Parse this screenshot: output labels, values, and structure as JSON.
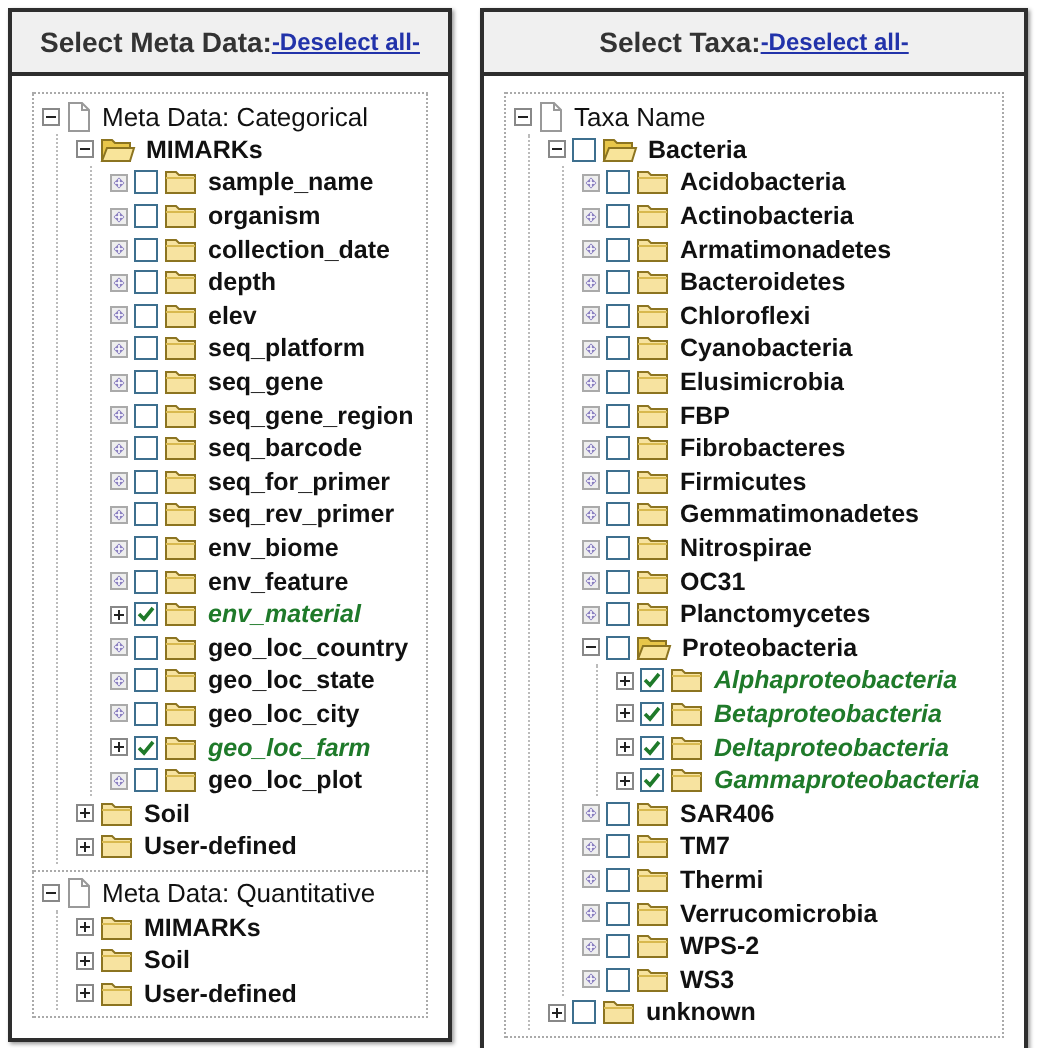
{
  "panels": [
    {
      "title": "Select Meta Data:",
      "link": "-Deselect all-",
      "sections": [
        {
          "kind": "page",
          "label": "Meta Data: Categorical",
          "expanded": true,
          "children": [
            {
              "kind": "folder",
              "label": "MIMARKs",
              "expanded": true,
              "children": [
                {
                  "kind": "folder",
                  "label": "sample_name",
                  "expanded": false,
                  "lazy": true,
                  "checked": false
                },
                {
                  "kind": "folder",
                  "label": "organism",
                  "expanded": false,
                  "lazy": true,
                  "checked": false
                },
                {
                  "kind": "folder",
                  "label": "collection_date",
                  "expanded": false,
                  "lazy": true,
                  "checked": false
                },
                {
                  "kind": "folder",
                  "label": "depth",
                  "expanded": false,
                  "lazy": true,
                  "checked": false
                },
                {
                  "kind": "folder",
                  "label": "elev",
                  "expanded": false,
                  "lazy": true,
                  "checked": false
                },
                {
                  "kind": "folder",
                  "label": "seq_platform",
                  "expanded": false,
                  "lazy": true,
                  "checked": false
                },
                {
                  "kind": "folder",
                  "label": "seq_gene",
                  "expanded": false,
                  "lazy": true,
                  "checked": false
                },
                {
                  "kind": "folder",
                  "label": "seq_gene_region",
                  "expanded": false,
                  "lazy": true,
                  "checked": false
                },
                {
                  "kind": "folder",
                  "label": "seq_barcode",
                  "expanded": false,
                  "lazy": true,
                  "checked": false
                },
                {
                  "kind": "folder",
                  "label": "seq_for_primer",
                  "expanded": false,
                  "lazy": true,
                  "checked": false
                },
                {
                  "kind": "folder",
                  "label": "seq_rev_primer",
                  "expanded": false,
                  "lazy": true,
                  "checked": false
                },
                {
                  "kind": "folder",
                  "label": "env_biome",
                  "expanded": false,
                  "lazy": true,
                  "checked": false
                },
                {
                  "kind": "folder",
                  "label": "env_feature",
                  "expanded": false,
                  "lazy": true,
                  "checked": false
                },
                {
                  "kind": "folder",
                  "label": "env_material",
                  "expanded": false,
                  "lazy": false,
                  "checked": true
                },
                {
                  "kind": "folder",
                  "label": "geo_loc_country",
                  "expanded": false,
                  "lazy": true,
                  "checked": false
                },
                {
                  "kind": "folder",
                  "label": "geo_loc_state",
                  "expanded": false,
                  "lazy": true,
                  "checked": false
                },
                {
                  "kind": "folder",
                  "label": "geo_loc_city",
                  "expanded": false,
                  "lazy": true,
                  "checked": false
                },
                {
                  "kind": "folder",
                  "label": "geo_loc_farm",
                  "expanded": false,
                  "lazy": false,
                  "checked": true
                },
                {
                  "kind": "folder",
                  "label": "geo_loc_plot",
                  "expanded": false,
                  "lazy": true,
                  "checked": false
                }
              ]
            },
            {
              "kind": "folder",
              "label": "Soil",
              "expanded": false,
              "lazy": false
            },
            {
              "kind": "folder",
              "label": "User-defined",
              "expanded": false,
              "lazy": false
            }
          ]
        },
        {
          "kind": "page",
          "label": "Meta Data: Quantitative",
          "expanded": true,
          "children": [
            {
              "kind": "folder",
              "label": "MIMARKs",
              "expanded": false,
              "lazy": false
            },
            {
              "kind": "folder",
              "label": "Soil",
              "expanded": false,
              "lazy": false
            },
            {
              "kind": "folder",
              "label": "User-defined",
              "expanded": false,
              "lazy": false
            }
          ]
        }
      ]
    },
    {
      "title": "Select Taxa:",
      "link": "-Deselect all-",
      "sections": [
        {
          "kind": "page",
          "label": "Taxa Name",
          "expanded": true,
          "children": [
            {
              "kind": "folder",
              "label": "Bacteria",
              "expanded": true,
              "checked": false,
              "children": [
                {
                  "kind": "folder",
                  "label": "Acidobacteria",
                  "expanded": false,
                  "lazy": true,
                  "checked": false
                },
                {
                  "kind": "folder",
                  "label": "Actinobacteria",
                  "expanded": false,
                  "lazy": true,
                  "checked": false
                },
                {
                  "kind": "folder",
                  "label": "Armatimonadetes",
                  "expanded": false,
                  "lazy": true,
                  "checked": false
                },
                {
                  "kind": "folder",
                  "label": "Bacteroidetes",
                  "expanded": false,
                  "lazy": true,
                  "checked": false
                },
                {
                  "kind": "folder",
                  "label": "Chloroflexi",
                  "expanded": false,
                  "lazy": true,
                  "checked": false
                },
                {
                  "kind": "folder",
                  "label": "Cyanobacteria",
                  "expanded": false,
                  "lazy": true,
                  "checked": false
                },
                {
                  "kind": "folder",
                  "label": "Elusimicrobia",
                  "expanded": false,
                  "lazy": true,
                  "checked": false
                },
                {
                  "kind": "folder",
                  "label": "FBP",
                  "expanded": false,
                  "lazy": true,
                  "checked": false
                },
                {
                  "kind": "folder",
                  "label": "Fibrobacteres",
                  "expanded": false,
                  "lazy": true,
                  "checked": false
                },
                {
                  "kind": "folder",
                  "label": "Firmicutes",
                  "expanded": false,
                  "lazy": true,
                  "checked": false
                },
                {
                  "kind": "folder",
                  "label": "Gemmatimonadetes",
                  "expanded": false,
                  "lazy": true,
                  "checked": false
                },
                {
                  "kind": "folder",
                  "label": "Nitrospirae",
                  "expanded": false,
                  "lazy": true,
                  "checked": false
                },
                {
                  "kind": "folder",
                  "label": "OC31",
                  "expanded": false,
                  "lazy": true,
                  "checked": false
                },
                {
                  "kind": "folder",
                  "label": "Planctomycetes",
                  "expanded": false,
                  "lazy": true,
                  "checked": false
                },
                {
                  "kind": "folder",
                  "label": "Proteobacteria",
                  "expanded": true,
                  "checked": false,
                  "children": [
                    {
                      "kind": "folder",
                      "label": "Alphaproteobacteria",
                      "expanded": false,
                      "lazy": false,
                      "checked": true
                    },
                    {
                      "kind": "folder",
                      "label": "Betaproteobacteria",
                      "expanded": false,
                      "lazy": false,
                      "checked": true
                    },
                    {
                      "kind": "folder",
                      "label": "Deltaproteobacteria",
                      "expanded": false,
                      "lazy": false,
                      "checked": true
                    },
                    {
                      "kind": "folder",
                      "label": "Gammaproteobacteria",
                      "expanded": false,
                      "lazy": false,
                      "checked": true
                    }
                  ]
                },
                {
                  "kind": "folder",
                  "label": "SAR406",
                  "expanded": false,
                  "lazy": true,
                  "checked": false
                },
                {
                  "kind": "folder",
                  "label": "TM7",
                  "expanded": false,
                  "lazy": true,
                  "checked": false
                },
                {
                  "kind": "folder",
                  "label": "Thermi",
                  "expanded": false,
                  "lazy": true,
                  "checked": false
                },
                {
                  "kind": "folder",
                  "label": "Verrucomicrobia",
                  "expanded": false,
                  "lazy": true,
                  "checked": false
                },
                {
                  "kind": "folder",
                  "label": "WPS-2",
                  "expanded": false,
                  "lazy": true,
                  "checked": false
                },
                {
                  "kind": "folder",
                  "label": "WS3",
                  "expanded": false,
                  "lazy": true,
                  "checked": false
                }
              ]
            },
            {
              "kind": "folder",
              "label": "unknown",
              "expanded": false,
              "lazy": false,
              "checked": false
            }
          ]
        }
      ]
    }
  ]
}
